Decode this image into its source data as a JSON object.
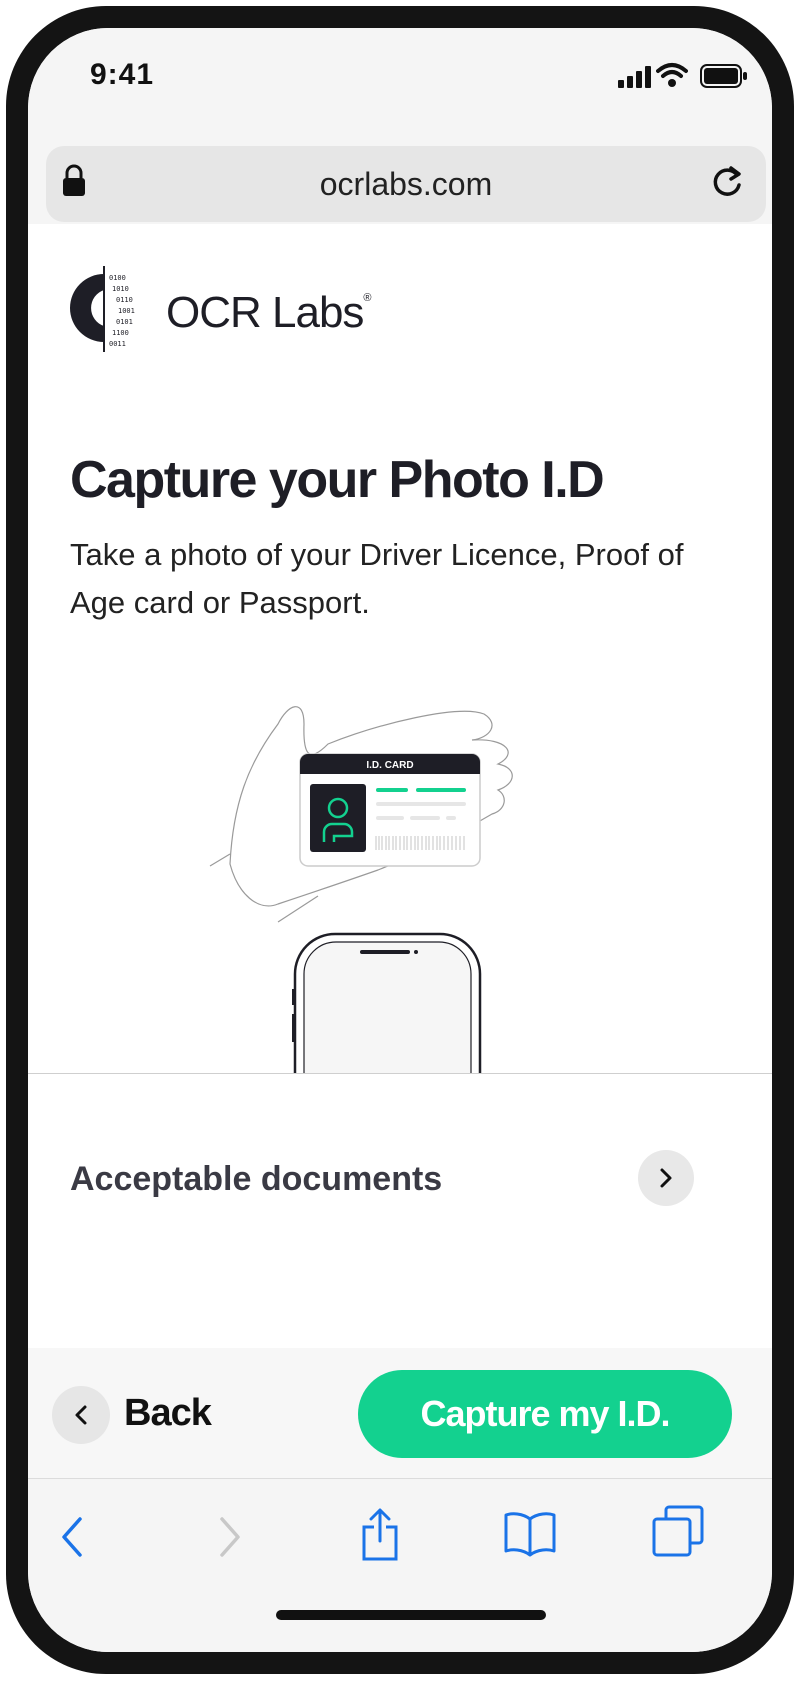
{
  "status_bar": {
    "time": "9:41"
  },
  "browser": {
    "url": "ocrlabs.com"
  },
  "brand": {
    "name": "OCR Labs",
    "trademark": "®"
  },
  "main": {
    "title": "Capture your Photo I.D",
    "description": "Take a photo of your Driver Licence, Proof of Age card or Passport.",
    "illustration": {
      "card_label": "I.D. CARD"
    },
    "acceptable_docs_label": "Acceptable documents"
  },
  "actions": {
    "back_label": "Back",
    "capture_label": "Capture my I.D."
  },
  "colors": {
    "accent": "#13d18f",
    "text_dark": "#1e1e26",
    "browser_blue": "#1a73e8"
  },
  "icons": {
    "lock": "lock-icon",
    "reload": "reload-icon",
    "chevron_right": "chevron-right-icon",
    "chevron_left": "chevron-left-icon",
    "share": "share-icon",
    "bookmarks": "bookmarks-icon",
    "tabs": "tabs-icon"
  }
}
